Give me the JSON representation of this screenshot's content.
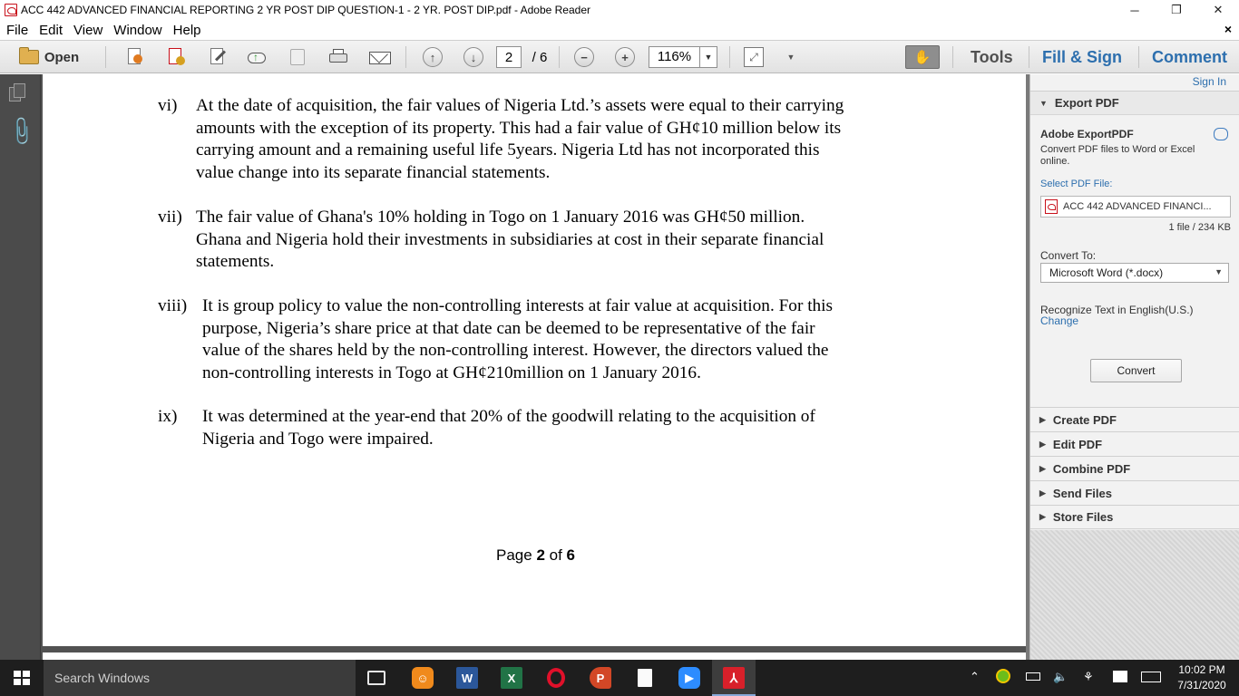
{
  "window": {
    "title": "ACC 442 ADVANCED FINANCIAL REPORTING 2 YR POST DIP QUESTION-1 - 2 YR. POST DIP.pdf - Adobe Reader",
    "minimize": "─",
    "restore": "❐",
    "close": "✕"
  },
  "menu": {
    "items": [
      "File",
      "Edit",
      "View",
      "Window",
      "Help"
    ],
    "doc_close": "×"
  },
  "toolbar": {
    "open_label": "Open",
    "current_page": "2",
    "total_pages": "/ 6",
    "zoom": "116%",
    "tools": "Tools",
    "fill_sign": "Fill & Sign",
    "comment": "Comment"
  },
  "document": {
    "items": [
      {
        "num": "vi)",
        "lines": [
          "At the date of acquisition, the fair values of Nigeria Ltd.’s assets were equal to their carrying",
          "amounts with the exception of its property. This had a fair value of GH¢10 million below its",
          "carrying amount and a remaining useful life 5years.  Nigeria Ltd has not incorporated this",
          "value change into its separate financial statements."
        ]
      },
      {
        "num": "vii)",
        "lines": [
          "The fair value of Ghana's 10% holding in Togo on 1 January 2016 was GH¢50 million.",
          "Ghana and Nigeria hold their investments in subsidiaries at cost in their separate financial",
          "statements."
        ]
      },
      {
        "num": "viii)",
        "lines": [
          "It is group policy to value the non-controlling interests at fair value at acquisition.  For this",
          "purpose, Nigeria’s share price at that date can be deemed to be representative of the fair",
          "value of the shares held by the non-controlling interest. However, the directors valued the",
          "non-controlling interests in Togo at GH¢210million on 1 January 2016."
        ]
      },
      {
        "num": "ix)",
        "lines": [
          "It was determined at the year-end that 20% of the goodwill relating to the acquisition of",
          "Nigeria and Togo were impaired."
        ]
      }
    ],
    "footer": {
      "prefix": "Page ",
      "page": "2",
      "mid": " of ",
      "total": "6"
    }
  },
  "right_panel": {
    "sign_in": "Sign In",
    "export_pdf": {
      "header": "Export PDF",
      "title": "Adobe ExportPDF",
      "description": "Convert PDF files to Word or Excel online.",
      "select_label": "Select PDF File:",
      "file_name": "ACC 442 ADVANCED FINANCI...",
      "file_count": "1 file / 234 KB",
      "convert_to_label": "Convert To:",
      "convert_to_value": "Microsoft Word (*.docx)",
      "recognize": "Recognize Text in English(U.S.)",
      "change": "Change",
      "convert_button": "Convert"
    },
    "sections": [
      "Create PDF",
      "Edit PDF",
      "Combine PDF",
      "Send Files",
      "Store Files"
    ]
  },
  "taskbar": {
    "search_placeholder": "Search Windows",
    "apps": [
      "task-view",
      "uc-browser",
      "word",
      "excel",
      "opera",
      "powerpoint",
      "notepad",
      "zoom",
      "adobe-reader"
    ],
    "time": "10:02 PM",
    "date": "7/31/2020"
  },
  "colors": {
    "accent_link": "#2d6fae",
    "reader_red": "#c8101a",
    "nav_dark": "#4b4b4b",
    "taskbar": "#1e1e1e"
  }
}
